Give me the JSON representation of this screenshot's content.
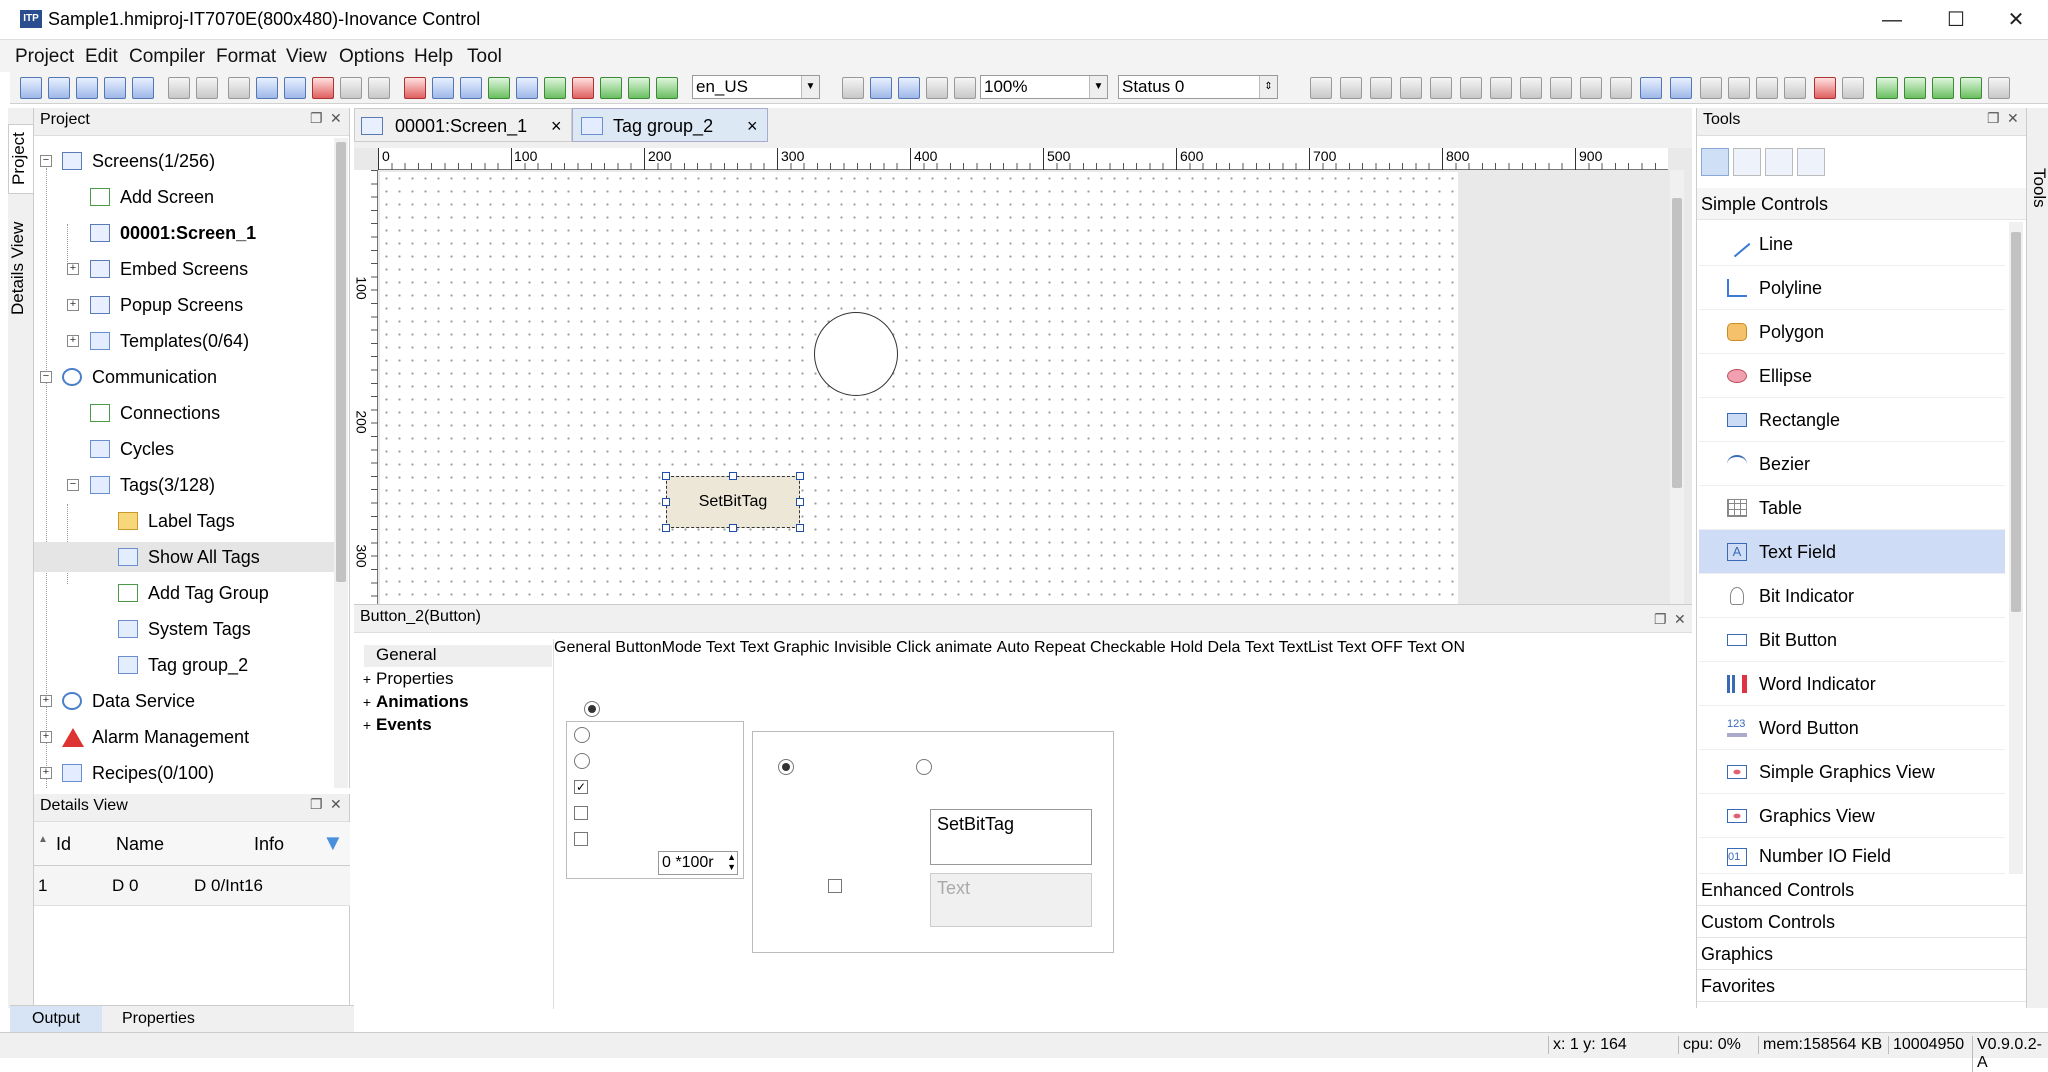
{
  "window": {
    "app_icon_text": "ITP",
    "title": "Sample1.hmiproj-IT7070E(800x480)-Inovance Control",
    "minimize": "—",
    "maximize": "☐",
    "close": "✕"
  },
  "menu": [
    "Project",
    "Edit",
    "Compiler",
    "Format",
    "View",
    "Options",
    "Help",
    "Tool"
  ],
  "toolbar": {
    "language": "en_US",
    "zoom": "100%",
    "status": "Status 0"
  },
  "left_tabs": [
    "Project",
    "Details View"
  ],
  "project_panel": {
    "title": "Project",
    "tree": [
      {
        "label": "Screens(1/256)",
        "icon": "screens-icon",
        "expand": "−"
      },
      {
        "label": "Add Screen",
        "icon": "add-screen-icon"
      },
      {
        "label": "00001:Screen_1",
        "icon": "screen-icon"
      },
      {
        "label": "Embed Screens",
        "icon": "embed-screen-icon",
        "expand": "+"
      },
      {
        "label": "Popup Screens",
        "icon": "popup-screen-icon",
        "expand": "+"
      },
      {
        "label": "Templates(0/64)",
        "icon": "template-icon",
        "expand": "+"
      },
      {
        "label": "Communication",
        "icon": "globe-icon",
        "expand": "−"
      },
      {
        "label": "Connections",
        "icon": "connection-icon"
      },
      {
        "label": "Cycles",
        "icon": "cycle-icon"
      },
      {
        "label": "Tags(3/128)",
        "icon": "tags-icon",
        "expand": "−"
      },
      {
        "label": "Label Tags",
        "icon": "folder-icon"
      },
      {
        "label": "Show All Tags",
        "icon": "show-tags-icon"
      },
      {
        "label": "Add Tag Group",
        "icon": "add-tag-group-icon"
      },
      {
        "label": "System Tags",
        "icon": "tag-icon"
      },
      {
        "label": "Tag group_2",
        "icon": "tag-icon"
      },
      {
        "label": "Data Service",
        "icon": "data-service-icon",
        "expand": "+"
      },
      {
        "label": "Alarm Management",
        "icon": "warning-icon",
        "expand": "+"
      },
      {
        "label": "Recipes(0/100)",
        "icon": "recipe-icon",
        "expand": "+"
      }
    ]
  },
  "details_view": {
    "title": "Details View",
    "columns": [
      "Id",
      "Name",
      "Info"
    ],
    "rows": [
      {
        "id": "1",
        "name": "D 0",
        "info": "D 0/Int16"
      }
    ]
  },
  "bottom_tabs": [
    "Output",
    "Properties"
  ],
  "editor_tabs": [
    {
      "label": "00001:Screen_1",
      "close": "×"
    },
    {
      "label": "Tag group_2",
      "close": "×"
    }
  ],
  "ruler": {
    "h_labels": [
      "0",
      "100",
      "200",
      "300",
      "400",
      "500",
      "600",
      "700",
      "800",
      "900"
    ],
    "v_labels": [
      "100",
      "200",
      "300"
    ]
  },
  "canvas": {
    "button_text": "SetBitTag"
  },
  "properties": {
    "title": "Button_2(Button)",
    "nav": [
      {
        "label": "General",
        "expand": ""
      },
      {
        "label": "Properties",
        "expand": "+"
      },
      {
        "label": "Animations",
        "expand": "+"
      },
      {
        "label": "Events",
        "expand": "+"
      }
    ],
    "header": "General",
    "button_mode_label": "ButtonMode",
    "modes": [
      "Text",
      "Graphic",
      "Invisible"
    ],
    "checks": [
      {
        "label": "Click animate",
        "checked": true
      },
      {
        "label": "Auto Repeat",
        "checked": false
      },
      {
        "label": "Checkable",
        "checked": false
      }
    ],
    "hold_label": "Hold Dela",
    "hold_value": "0 *100r",
    "text_group_label": "Text",
    "text_radio": "Text",
    "textlist_radio": "TextList",
    "text_off_label": "Text OFF",
    "text_off_value": "SetBitTag",
    "text_on_label": "Text ON",
    "text_on_placeholder": "Text"
  },
  "tools": {
    "title": "Tools",
    "side_tab": "Tools",
    "section": "Simple Controls",
    "items": [
      {
        "label": "Line",
        "icon": "line-icon"
      },
      {
        "label": "Polyline",
        "icon": "polyline-icon"
      },
      {
        "label": "Polygon",
        "icon": "polygon-icon"
      },
      {
        "label": "Ellipse",
        "icon": "ellipse-icon"
      },
      {
        "label": "Rectangle",
        "icon": "rectangle-icon"
      },
      {
        "label": "Bezier",
        "icon": "bezier-icon"
      },
      {
        "label": "Table",
        "icon": "table-icon"
      },
      {
        "label": "Text Field",
        "icon": "text-field-icon"
      },
      {
        "label": "Bit Indicator",
        "icon": "bit-indicator-icon"
      },
      {
        "label": "Bit Button",
        "icon": "bit-button-icon"
      },
      {
        "label": "Word Indicator",
        "icon": "word-indicator-icon"
      },
      {
        "label": "Word Button",
        "icon": "word-button-icon"
      },
      {
        "label": "Simple Graphics View",
        "icon": "graphics-view-icon"
      },
      {
        "label": "Graphics View",
        "icon": "graphics-view-icon"
      },
      {
        "label": "Number IO Field",
        "icon": "number-io-icon"
      }
    ],
    "categories": [
      "Enhanced Controls",
      "Custom Controls",
      "Graphics",
      "Favorites"
    ]
  },
  "statusbar": {
    "coords": "x: 1 y: 164",
    "cpu": "cpu: 0%",
    "mem": "mem:158564 KB",
    "id": "10004950",
    "version": "V0.9.0.2-A"
  }
}
